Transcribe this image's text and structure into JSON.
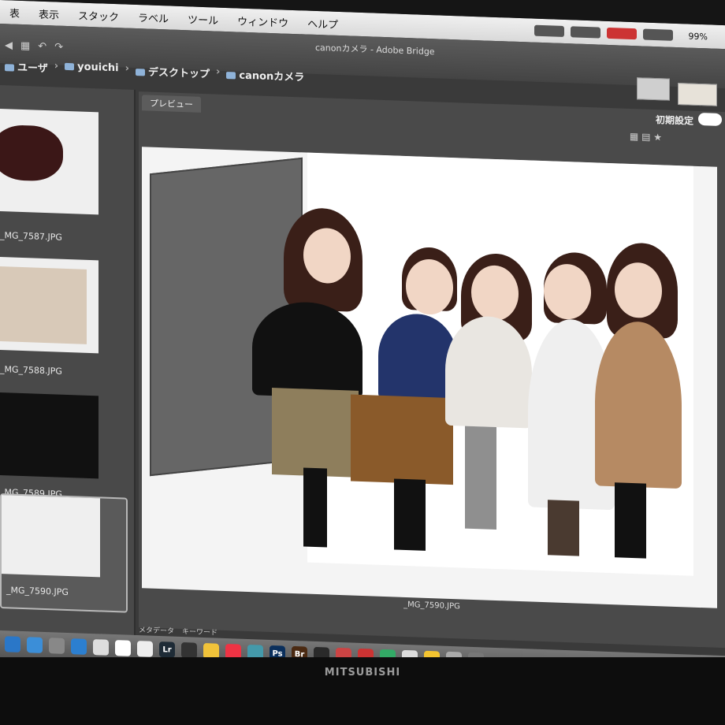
{
  "menubar": {
    "items": [
      "表",
      "表示",
      "スタック",
      "ラベル",
      "ツール",
      "ウィンドウ",
      "ヘルプ"
    ],
    "battery": "99%"
  },
  "window": {
    "title": "canonカメラ - Adobe Bridge"
  },
  "breadcrumb": {
    "items": [
      "ユーザ",
      "youichi",
      "デスクトップ",
      "canonカメラ"
    ]
  },
  "preview": {
    "tab_label": "プレビュー",
    "preset_label": "初期設定",
    "caption": "_MG_7590.JPG"
  },
  "sidebar": {
    "thumbnails": [
      {
        "label": "_MG_7587.JPG"
      },
      {
        "label": "_MG_7588.JPG"
      },
      {
        "label": "_MG_7589.JPG"
      },
      {
        "label": "_MG_7590.JPG"
      }
    ]
  },
  "bottom_tabs": [
    "メタデータ",
    "キーワード"
  ],
  "dock": {
    "apps": [
      "",
      "",
      "",
      "",
      "",
      "",
      "",
      "Lr",
      "",
      "",
      "",
      "",
      "Ps",
      "Br",
      "",
      "",
      "",
      "",
      "",
      "",
      "",
      ""
    ]
  },
  "monitor": {
    "brand": "MITSUBISHI"
  }
}
